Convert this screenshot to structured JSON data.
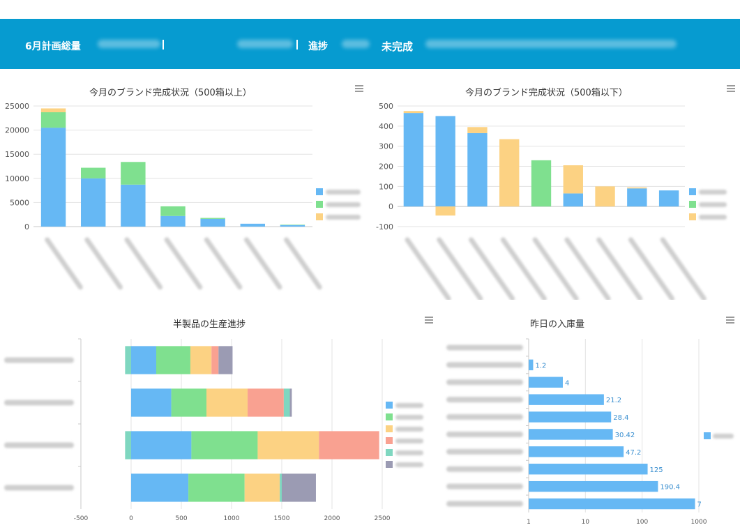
{
  "header": {
    "plan_total_label": "6月計画総量",
    "progress_label": "進捗",
    "incomplete_label": "未完成",
    "bg_color": "#069bd0"
  },
  "colors": {
    "blue": "#66b8f4",
    "green": "#7fe08f",
    "yellow": "#fcd283",
    "red": "#f9a191",
    "teal": "#7fd7c0",
    "purple": "#9b9bb3"
  },
  "chart_data": [
    {
      "id": "brand_over_500",
      "type": "bar",
      "stacked": true,
      "title": "今月のブランド完成状況（500箱以上）",
      "categories": [
        "",
        "",
        "",
        "",
        "",
        "",
        ""
      ],
      "ylim": [
        0,
        25000
      ],
      "yticks": [
        0,
        5000,
        10000,
        15000,
        20000,
        25000
      ],
      "series": [
        {
          "color": "#66b8f4",
          "values": [
            20500,
            10000,
            8700,
            2200,
            1600,
            600,
            300
          ]
        },
        {
          "color": "#7fe08f",
          "values": [
            3200,
            2200,
            4700,
            2000,
            200,
            0,
            100
          ]
        },
        {
          "color": "#fcd283",
          "values": [
            800,
            0,
            0,
            0,
            0,
            0,
            0
          ]
        }
      ],
      "legend": "right",
      "grid": true
    },
    {
      "id": "brand_under_500",
      "type": "bar",
      "stacked": true,
      "title": "今月のブランド完成状況（500箱以下）",
      "categories": [
        "",
        "",
        "",
        "",
        "",
        "",
        "",
        "",
        ""
      ],
      "ylim": [
        -100,
        500
      ],
      "yticks": [
        -100,
        0,
        100,
        200,
        300,
        400,
        500
      ],
      "series": [
        {
          "color": "#66b8f4",
          "values": [
            465,
            450,
            365,
            0,
            0,
            65,
            0,
            90,
            80
          ]
        },
        {
          "color": "#7fe08f",
          "values": [
            0,
            0,
            0,
            0,
            230,
            0,
            0,
            0,
            0
          ]
        },
        {
          "color": "#fcd283",
          "values": [
            10,
            -45,
            30,
            335,
            0,
            140,
            100,
            5,
            0
          ]
        }
      ],
      "legend": "right",
      "grid": true
    },
    {
      "id": "semi_finished_progress",
      "type": "bar",
      "orientation": "horizontal",
      "stacked": true,
      "title": "半製品の生産進捗",
      "categories": [
        "",
        "",
        "",
        ""
      ],
      "xlim": [
        -500,
        2500
      ],
      "xticks": [
        -500,
        0,
        500,
        1000,
        1500,
        2000,
        2500
      ],
      "series": [
        {
          "color": "#7fd7c0",
          "values": [
            -60,
            0,
            -60,
            0
          ]
        },
        {
          "color": "#66b8f4",
          "values": [
            250,
            400,
            600,
            570
          ]
        },
        {
          "color": "#7fe08f",
          "values": [
            340,
            350,
            660,
            560
          ]
        },
        {
          "color": "#fcd283",
          "values": [
            210,
            410,
            610,
            350
          ]
        },
        {
          "color": "#f9a191",
          "values": [
            70,
            360,
            600,
            0
          ]
        },
        {
          "color": "#7fd7c0",
          "values": [
            0,
            60,
            0,
            20
          ]
        },
        {
          "color": "#9b9bb3",
          "values": [
            140,
            20,
            0,
            340
          ]
        }
      ],
      "legend": "right",
      "grid": true
    },
    {
      "id": "yesterday_inbound",
      "type": "bar",
      "orientation": "horizontal",
      "title": "昨日の入庫量",
      "x_scale": "log",
      "xlim": [
        1,
        1000
      ],
      "xticks": [
        1,
        10,
        100,
        1000
      ],
      "categories": [
        "",
        "",
        "",
        "",
        "",
        "",
        "",
        "",
        "",
        ""
      ],
      "values": [
        1,
        1.2,
        4,
        21.2,
        28.4,
        30.42,
        47.2,
        125,
        190.4,
        857
      ],
      "data_labels": [
        "",
        "1.2",
        "4",
        "21.2",
        "28.4",
        "30.42",
        "47.2",
        "125",
        "190.4",
        "7"
      ],
      "color": "#66b8f4",
      "legend": "right",
      "grid": true
    }
  ]
}
